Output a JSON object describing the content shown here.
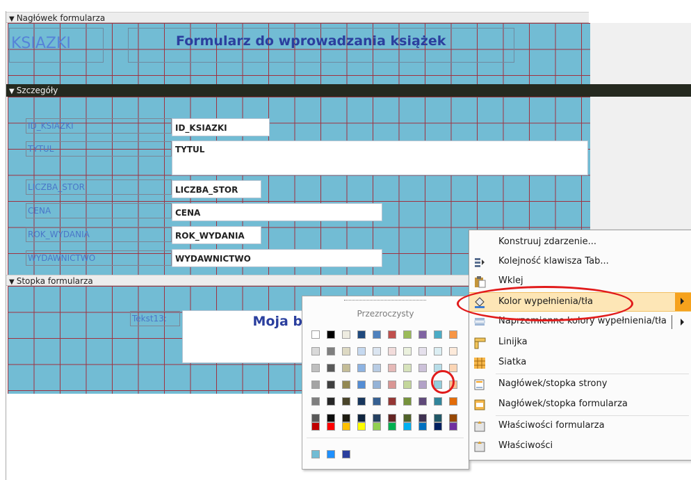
{
  "sections": {
    "header_label": "Nagłówek formularza",
    "detail_label": "Szczegóły",
    "footer_label": "Stopka formularza"
  },
  "header": {
    "logo_text": "KSIAZKI",
    "title": "Formularz do wprowadzania książek"
  },
  "detail_fields": [
    {
      "label": "ID_KSIAZKI",
      "value": "ID_KSIAZKI"
    },
    {
      "label": "TYTUL",
      "value": "TYTUL"
    },
    {
      "label": "LICZBA_STOR",
      "value": "LICZBA_STOR"
    },
    {
      "label": "CENA",
      "value": "CENA"
    },
    {
      "label": "ROK_WYDANIA",
      "value": "ROK_WYDANIA"
    },
    {
      "label": "WYDAWNICTWO",
      "value": "WYDAWNICTWO"
    }
  ],
  "footer": {
    "text_label": "Tekst13:",
    "box_text": "Moja b"
  },
  "palette": {
    "transparent_label": "Przezroczysty",
    "rows": [
      [
        "#ffffff",
        "#000000",
        "#eeece1",
        "#1f497d",
        "#4f81bd",
        "#c0504d",
        "#9bbb59",
        "#8064a2",
        "#4bacc6",
        "#f79646"
      ],
      [
        "#d9d9d9",
        "#7f7f7f",
        "#ddd9c3",
        "#c6d9f0",
        "#dbe5f1",
        "#f2dcdb",
        "#ebf1dd",
        "#e5e0ec",
        "#dbeef3",
        "#fdeada"
      ],
      [
        "#bfbfbf",
        "#595959",
        "#c4bd97",
        "#8db3e2",
        "#b8cce4",
        "#e5b9b7",
        "#d7e3bc",
        "#ccc1d9",
        "#b7dde8",
        "#fbd5b5"
      ],
      [
        "#a5a5a5",
        "#3f3f3f",
        "#938953",
        "#548dd4",
        "#95b3d7",
        "#d99694",
        "#c3d69b",
        "#b2a2c7",
        "#92cddc",
        "#fac08f"
      ],
      [
        "#7f7f7f",
        "#262626",
        "#494429",
        "#17365d",
        "#366092",
        "#953734",
        "#76923c",
        "#5f497a",
        "#31859b",
        "#e36c09"
      ],
      [
        "#595959",
        "#0c0c0c",
        "#1d1b10",
        "#0f243e",
        "#244061",
        "#632423",
        "#4f6128",
        "#3f3151",
        "#205867",
        "#974806"
      ],
      [
        "#c00000",
        "#ff0000",
        "#ffc000",
        "#ffff00",
        "#92d050",
        "#00b050",
        "#00b0f0",
        "#0070c0",
        "#002060",
        "#7030a0"
      ]
    ],
    "recent": [
      "#72bcd4",
      "#1e90ff",
      "#2b3f9e"
    ]
  },
  "context_menu": {
    "items": [
      {
        "label": "Konstruuj zdarzenie...",
        "icon": "none-icon"
      },
      {
        "label": "Kolejność klawisza Tab...",
        "icon": "tab-order-icon"
      },
      {
        "label": "Wklej",
        "icon": "paste-icon"
      },
      {
        "label": "Kolor wypełnienia/tła",
        "icon": "fill-color-icon"
      },
      {
        "label": "Naprzemienne kolory wypełnienia/tła",
        "icon": "alternate-fill-icon"
      },
      {
        "label": "Linijka",
        "icon": "ruler-icon"
      },
      {
        "label": "Siatka",
        "icon": "grid-icon"
      },
      {
        "label": "Nagłówek/stopka strony",
        "icon": "page-header-icon"
      },
      {
        "label": "Nagłówek/stopka formularza",
        "icon": "form-header-icon"
      },
      {
        "label": "Właściwości formularza",
        "icon": "form-properties-icon"
      },
      {
        "label": "Właściwości",
        "icon": "properties-icon"
      }
    ]
  },
  "colors": {
    "section_bg": "#72bcd4",
    "grid_line": "#a0313f",
    "highlight": "#fde6b6",
    "submenu_arrow_bg": "#f6a21d",
    "annotation": "#e11b1b"
  }
}
